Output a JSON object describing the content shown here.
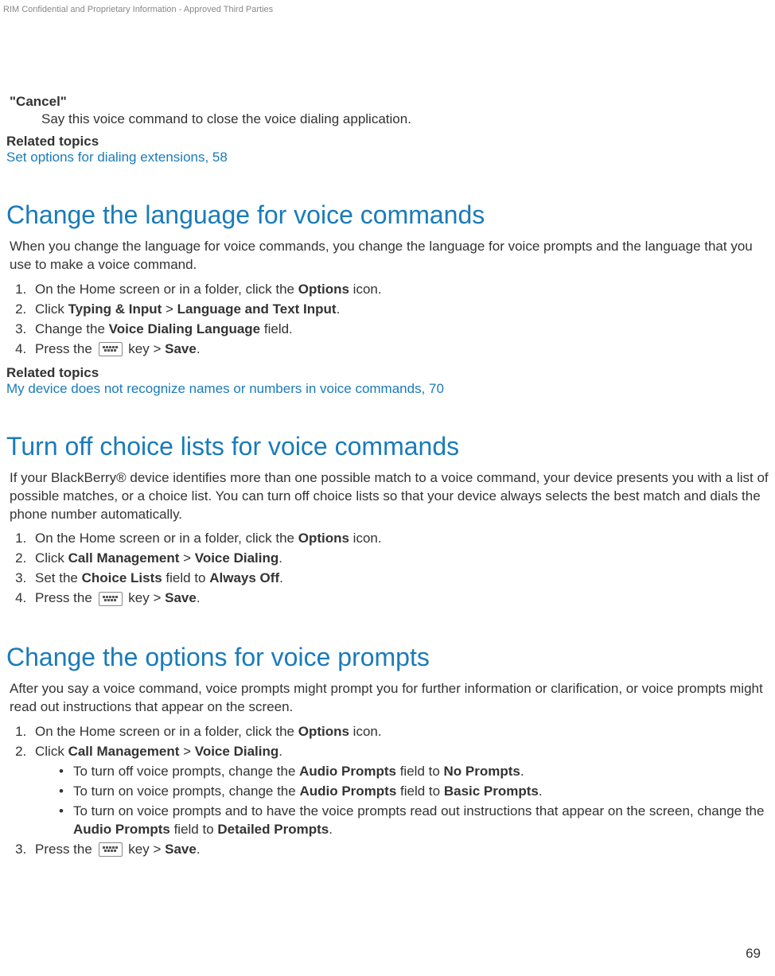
{
  "header_note": "RIM Confidential and Proprietary Information - Approved Third Parties",
  "page_number": "69",
  "cancel": {
    "term": "\"Cancel\"",
    "definition": "Say this voice command to close the voice dialing application."
  },
  "related1": {
    "heading": "Related topics",
    "link": "Set options for dialing extensions, 58"
  },
  "section1": {
    "title": "Change the language for voice commands",
    "intro": "When you change the language for voice commands, you change the language for voice prompts and the language that you use to make a voice command.",
    "s1_pre": "On the Home screen or in a folder, click the ",
    "s1_b": "Options",
    "s1_post": " icon.",
    "s2_pre": "Click ",
    "s2_b1": "Typing & Input",
    "s2_mid": " > ",
    "s2_b2": "Language and Text Input",
    "s2_post": ".",
    "s3_pre": "Change the ",
    "s3_b": "Voice Dialing Language",
    "s3_post": " field.",
    "s4_pre": "Press the ",
    "s4_mid": " key > ",
    "s4_b": "Save",
    "s4_post": "."
  },
  "related2": {
    "heading": "Related topics",
    "link": "My device does not recognize names or numbers in voice commands, 70"
  },
  "section2": {
    "title": "Turn off choice lists for voice commands",
    "intro": "If your BlackBerry® device identifies more than one possible match to a voice command, your device presents you with a list of possible matches, or a choice list. You can turn off choice lists so that your device always selects the best match and dials the phone number automatically.",
    "s1_pre": "On the Home screen or in a folder, click the ",
    "s1_b": "Options",
    "s1_post": " icon.",
    "s2_pre": "Click ",
    "s2_b1": "Call Management",
    "s2_mid": " > ",
    "s2_b2": "Voice Dialing",
    "s2_post": ".",
    "s3_pre": "Set the ",
    "s3_b1": "Choice Lists",
    "s3_mid": " field to ",
    "s3_b2": "Always Off",
    "s3_post": ".",
    "s4_pre": "Press the ",
    "s4_mid": " key > ",
    "s4_b": "Save",
    "s4_post": "."
  },
  "section3": {
    "title": "Change the options for voice prompts",
    "intro": "After you say a voice command, voice prompts might prompt you for further information or clarification, or voice prompts might read out instructions that appear on the screen.",
    "s1_pre": "On the Home screen or in a folder, click the ",
    "s1_b": "Options",
    "s1_post": " icon.",
    "s2_pre": "Click ",
    "s2_b1": "Call Management",
    "s2_mid": " > ",
    "s2_b2": "Voice Dialing",
    "s2_post": ".",
    "b1_pre": "To turn off voice prompts, change the ",
    "b1_b1": "Audio Prompts",
    "b1_mid": " field to ",
    "b1_b2": "No Prompts",
    "b1_post": ".",
    "b2_pre": "To turn on voice prompts, change the ",
    "b2_b1": "Audio Prompts",
    "b2_mid": " field to ",
    "b2_b2": "Basic Prompts",
    "b2_post": ".",
    "b3_pre": "To turn on voice prompts and to have the voice prompts read out instructions that appear on the screen, change the ",
    "b3_b1": "Audio Prompts",
    "b3_mid": " field to ",
    "b3_b2": "Detailed Prompts",
    "b3_post": ".",
    "s3_pre": "Press the ",
    "s3_mid": " key > ",
    "s3_b": "Save",
    "s3_post": "."
  }
}
